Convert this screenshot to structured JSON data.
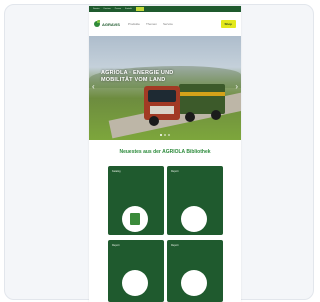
{
  "site": {
    "logo": "AGRAVIS",
    "topbar": [
      "Service",
      "Karriere",
      "Presse",
      "Kontakt"
    ],
    "menu": [
      "Produkte",
      "Themen",
      "Service"
    ],
    "cta": "Shop"
  },
  "hero": {
    "title": "AGRIOLA · ENERGIE UND MOBILITÄT VOM LAND",
    "prev": "‹",
    "next": "›"
  },
  "section": {
    "title": "Neuestes aus der AGRIOLA Bibliothek"
  },
  "tiles": [
    {
      "heading": "Katalog",
      "text": ""
    },
    {
      "heading": "Report",
      "text": ""
    },
    {
      "heading": "Report",
      "text": ""
    },
    {
      "heading": "Report",
      "text": ""
    }
  ],
  "colors": {
    "brand_green": "#1f5a2e",
    "accent_yellow": "#e3e81c",
    "title_green": "#2b8a3a"
  }
}
